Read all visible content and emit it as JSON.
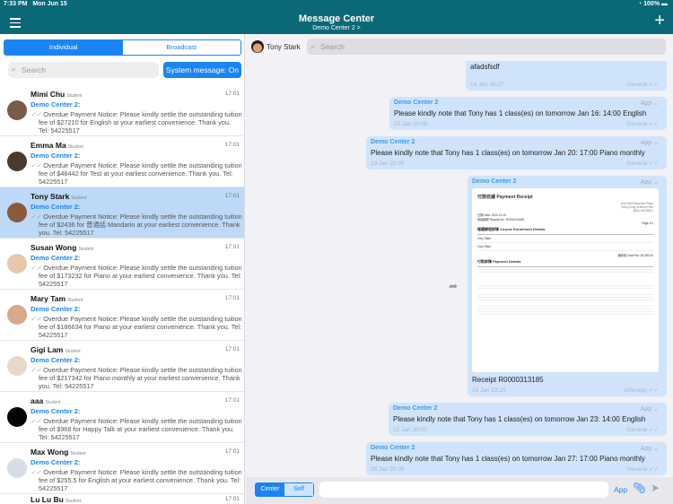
{
  "status": {
    "time": "7:33 PM",
    "date": "Mon Jun 15",
    "battery": "100%"
  },
  "header": {
    "title": "Message Center",
    "subtitle": "Demo Center 2 >"
  },
  "left": {
    "tabs": [
      "Individual",
      "Broadcast"
    ],
    "search_placeholder": "Search",
    "system_button": "System message: On",
    "conversations": [
      {
        "name": "Mimi Chu",
        "role": "Student",
        "time": "17:01",
        "center": "Demo Center 2:",
        "message": "Overdue Payment Notice: Please kindly settle the outstanding tuition fee of $27210 for English at your earliest convenience. Thank you. Tel: 54225517",
        "avatar": "#7a5a48"
      },
      {
        "name": "Emma Ma",
        "role": "Student",
        "time": "17:01",
        "center": "Demo Center 2:",
        "message": "Overdue Payment Notice: Please kindly settle the outstanding tuition fee of $48442 for Test at your earliest convenience. Thank you. Tel: 54225517",
        "avatar": "#4a3a30"
      },
      {
        "name": "Tony Stark",
        "role": "Student",
        "time": "17:01",
        "center": "Demo Center 2:",
        "message": "Overdue Payment Notice: Please kindly settle the outstanding tuition fee of $2436 for 普通話 Mandarin at your earliest convenience. Thank you. Tel: 54225517",
        "avatar": "#8a5a3a"
      },
      {
        "name": "Susan Wong",
        "role": "Student",
        "time": "17:01",
        "center": "Demo Center 2:",
        "message": "Overdue Payment Notice: Please kindly settle the outstanding tuition fee of $173232 for Piano at your earliest convenience. Thank you. Tel: 54225517",
        "avatar": "#e8c8a8"
      },
      {
        "name": "Mary Tam",
        "role": "Student",
        "time": "17:01",
        "center": "Demo Center 2:",
        "message": "Overdue Payment Notice: Please kindly settle the outstanding tuition fee of $186634 for Piano at your earliest convenience. Thank you. Tel: 54225517",
        "avatar": "#d8a888"
      },
      {
        "name": "Gigi Lam",
        "role": "Student",
        "time": "17:01",
        "center": "Demo Center 2:",
        "message": "Overdue Payment Notice: Please kindly settle the outstanding tuition fee of $217342 for Piano monthly at your earliest convenience. Thank you. Tel: 54225517",
        "avatar": "#e8d8c8"
      },
      {
        "name": "aaa",
        "role": "Student",
        "time": "17:01",
        "center": "Demo Center 2:",
        "message": "Overdue Payment Notice: Please kindly settle the outstanding tuition fee of $968 for Happy Talk at your earliest convenience. Thank you. Tel: 54225517",
        "avatar": "#050505"
      },
      {
        "name": "Max Wong",
        "role": "Student",
        "time": "17:01",
        "center": "Demo Center 2:",
        "message": "Overdue Payment Notice: Please kindly settle the outstanding tuition fee of $255.5 for English at your earliest convenience. Thank you. Tel: 54225517",
        "avatar": "#d8dcea"
      },
      {
        "name": "Lu Lu Bu",
        "role": "Student",
        "time": "17:01",
        "center": "",
        "message": "",
        "avatar": "#ccc"
      }
    ]
  },
  "chat": {
    "contact": "Tony Stark",
    "search_placeholder": "Search",
    "first": {
      "text": "afadsfsdf",
      "date": "14 Jan 16:27",
      "tag": "General"
    },
    "messages": [
      {
        "from": "Demo Center 2",
        "via": "App",
        "text": "Please kindly note that Tony has 1 class(es) on tomorrow Jan 16: 14:00 English",
        "date": "15 Jan 20:05",
        "tag": "General"
      },
      {
        "from": "Demo Center 2",
        "via": "App",
        "text": "Please kindly note that Tony has 1 class(es) on tomorrow Jan 20: 17:00 Piano monthly",
        "date": "19 Jan 20:05",
        "tag": "General"
      },
      {
        "from": "Demo Center 2",
        "via": "App",
        "text": "Receipt R0000313185",
        "date": "19 Jan 23:25",
        "tag": "eReceipt"
      },
      {
        "from": "Demo Center 2",
        "via": "App",
        "text": "Please kindly note that Tony has 1 class(es) on tomorrow Jan 23: 14:00 English",
        "date": "22 Jan 20:05",
        "tag": "General"
      },
      {
        "from": "Demo Center 2",
        "via": "App",
        "text": "Please kindly note that Tony has 1 class(es) on tomorrow Jan 27: 17:00 Piano monthly",
        "date": "26 Jan 20:05",
        "tag": "General"
      }
    ],
    "receipt": {
      "title": "付款收據 Payment Receipt",
      "date": "日期 Date: 2020-01-19",
      "no": "收據編號 Receipt No.: R0000313185",
      "page": "Page 1/1",
      "enroll": "報讀課程詳情 Course Enrollment Details:",
      "payment": "付款詳情 Payment Details:",
      "student": "Tony Stark",
      "total": "總費用 Total Fee: $3,350.00"
    },
    "bottom": {
      "toggle": [
        "Center",
        "Self"
      ],
      "app": "App"
    }
  }
}
